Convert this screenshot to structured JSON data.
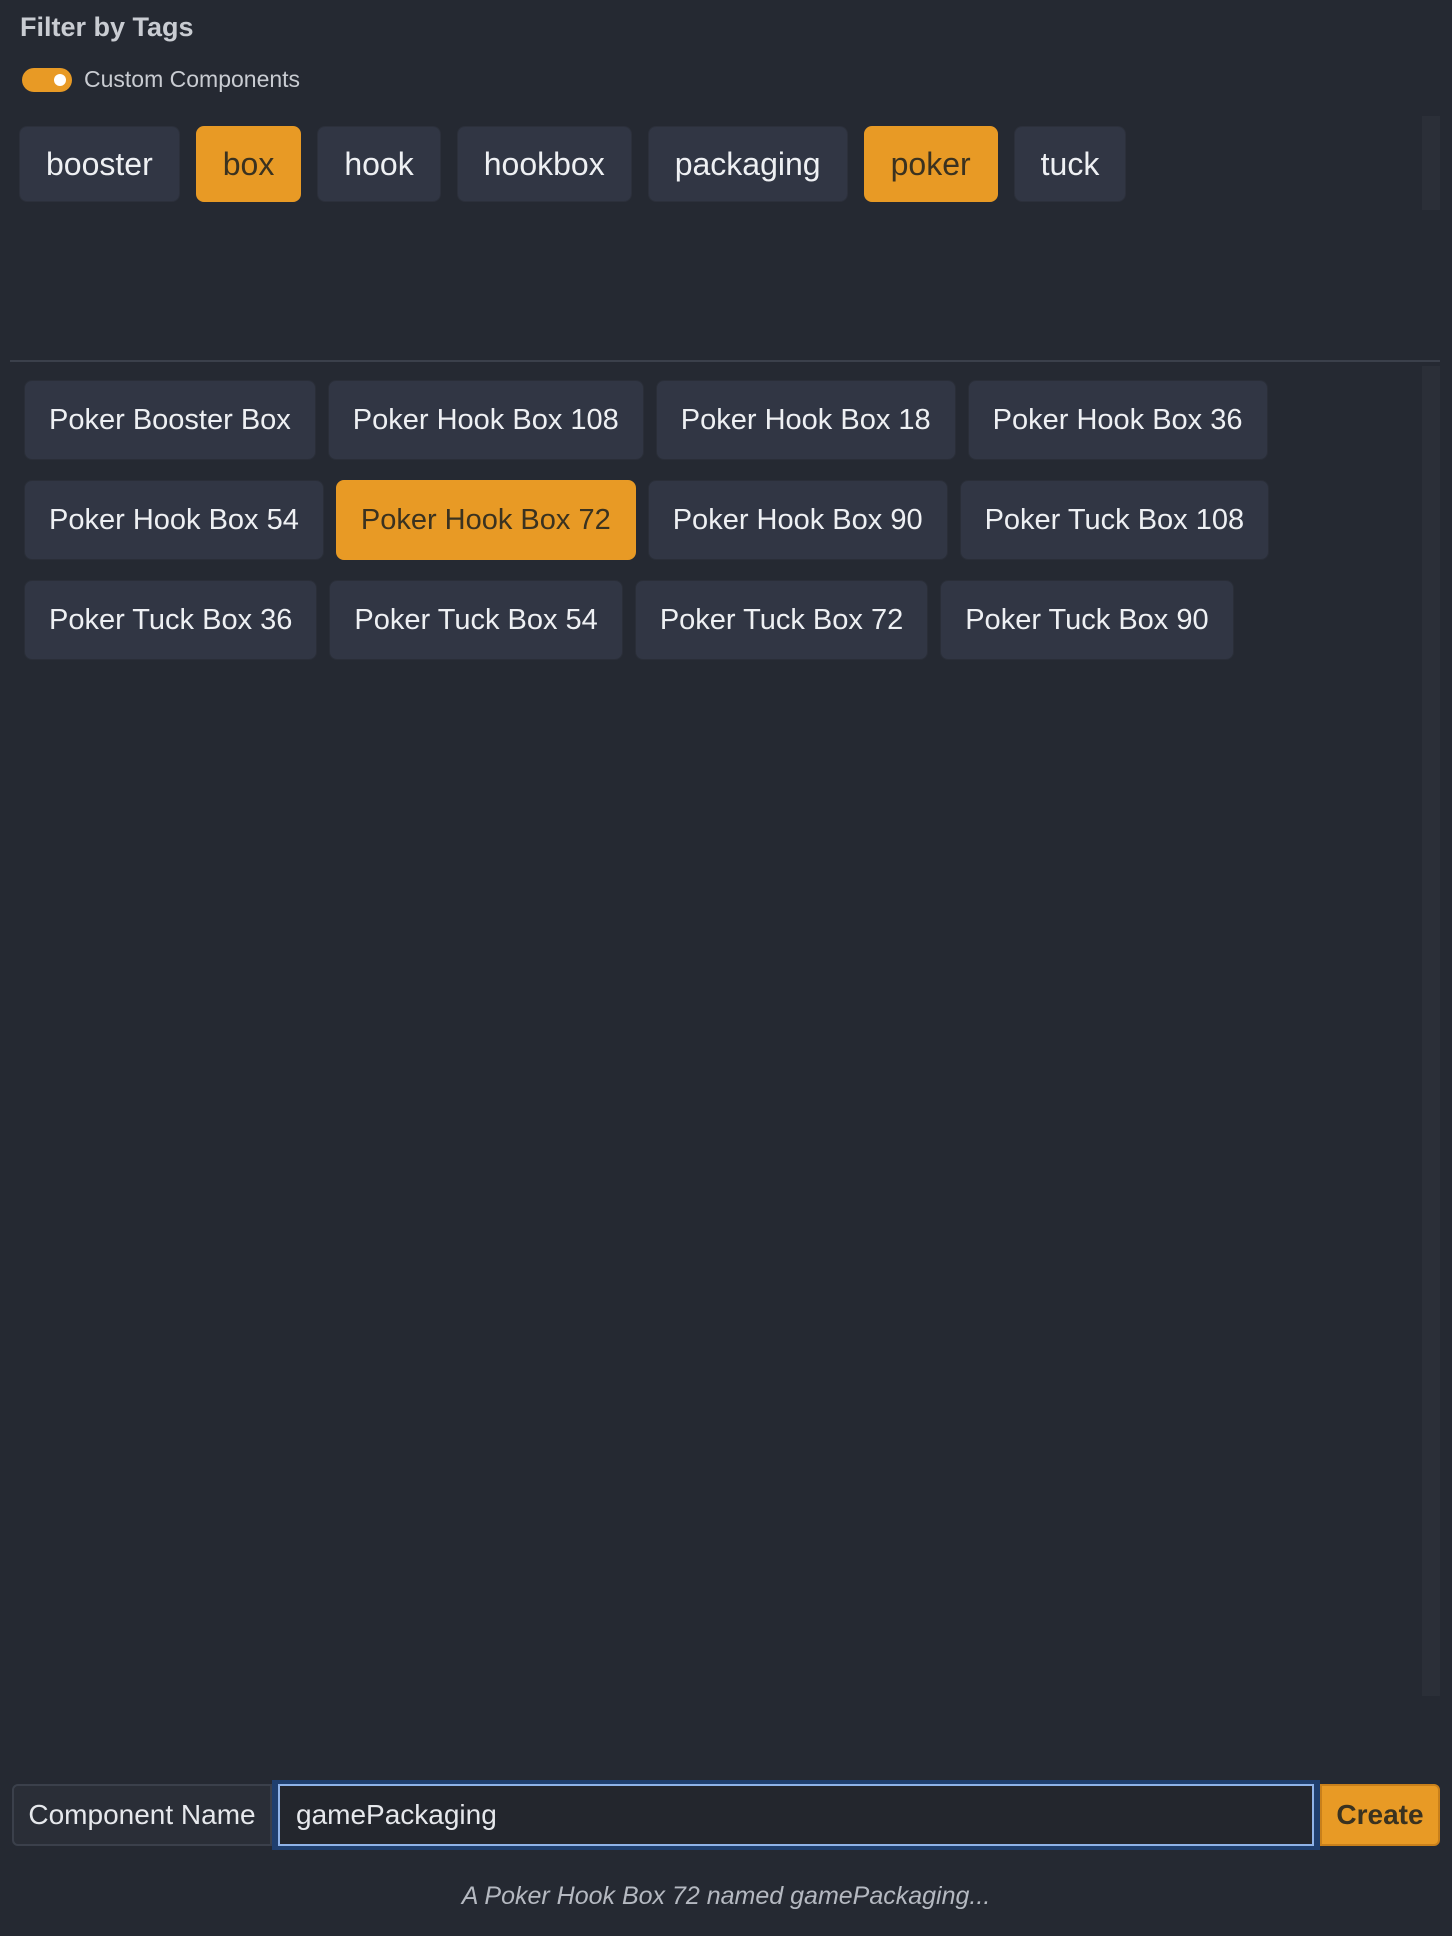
{
  "filter": {
    "title": "Filter by Tags",
    "toggle_label": "Custom Components",
    "toggle_on": true,
    "tags": [
      {
        "label": "booster",
        "active": false
      },
      {
        "label": "box",
        "active": true
      },
      {
        "label": "hook",
        "active": false
      },
      {
        "label": "hookbox",
        "active": false
      },
      {
        "label": "packaging",
        "active": false
      },
      {
        "label": "poker",
        "active": true
      },
      {
        "label": "tuck",
        "active": false
      }
    ]
  },
  "components": [
    {
      "label": "Poker Booster Box",
      "active": false
    },
    {
      "label": "Poker Hook Box 108",
      "active": false
    },
    {
      "label": "Poker Hook Box 18",
      "active": false
    },
    {
      "label": "Poker Hook Box 36",
      "active": false
    },
    {
      "label": "Poker Hook Box 54",
      "active": false
    },
    {
      "label": "Poker Hook Box 72",
      "active": true
    },
    {
      "label": "Poker Hook Box 90",
      "active": false
    },
    {
      "label": "Poker Tuck Box 108",
      "active": false
    },
    {
      "label": "Poker Tuck Box 36",
      "active": false
    },
    {
      "label": "Poker Tuck Box 54",
      "active": false
    },
    {
      "label": "Poker Tuck Box 72",
      "active": false
    },
    {
      "label": "Poker Tuck Box 90",
      "active": false
    }
  ],
  "form": {
    "name_label": "Component Name",
    "name_value": "gamePackaging",
    "create_label": "Create"
  },
  "status": "A Poker Hook Box 72 named gamePackaging...",
  "colors": {
    "background": "#252932",
    "chip": "#313644",
    "accent": "#e89a25",
    "focus": "#1f3f6e"
  }
}
